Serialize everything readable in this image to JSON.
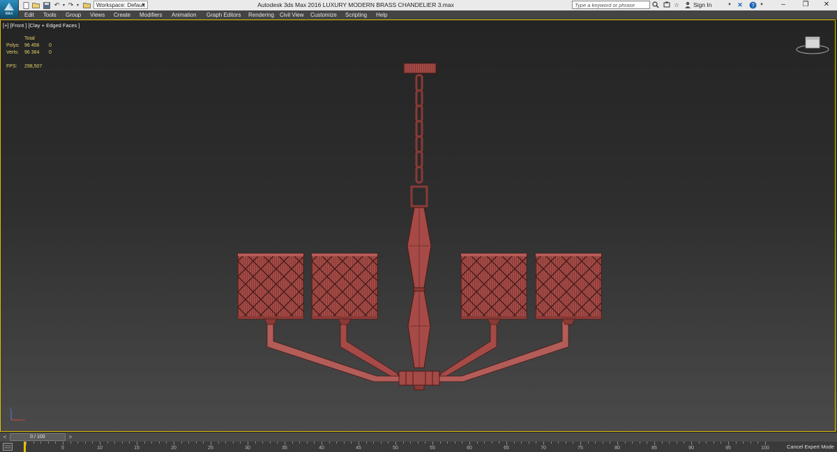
{
  "app": {
    "logo_text": "MAX",
    "workspace": "Workspace: Default",
    "window_title": "Autodesk 3ds Max 2016     LUXURY MODERN BRASS CHANDELIER 3.max",
    "search_placeholder": "Type a keyword or phrase",
    "sign_in": "Sign In"
  },
  "menu": [
    "Edit",
    "Tools",
    "Group",
    "Views",
    "Create",
    "Modifiers",
    "Animation",
    "Graph Editors",
    "Rendering",
    "Civil View",
    "Customize",
    "Scripting",
    "Help"
  ],
  "viewport": {
    "label": "[+] [Front ] [Clay + Edged Faces ]",
    "stats": {
      "header": "Total",
      "polys_label": "Polys:",
      "polys_total": "96 456",
      "polys_sel": "0",
      "verts_label": "Verts:",
      "verts_total": "96 364",
      "verts_sel": "0",
      "fps_label": "FPS:",
      "fps_value": "298,507"
    }
  },
  "timeline": {
    "frame_display": "0 / 100",
    "ticks": [
      "0",
      "5",
      "10",
      "15",
      "20",
      "25",
      "30",
      "35",
      "40",
      "45",
      "50",
      "55",
      "60",
      "65",
      "70",
      "75",
      "80",
      "85",
      "90",
      "95",
      "100"
    ],
    "cancel_expert": "Cancel Expert Mode"
  },
  "colors": {
    "model": "#9e4a46",
    "viewport_border": "#e0c000",
    "stats_text": "#e6d26a"
  }
}
